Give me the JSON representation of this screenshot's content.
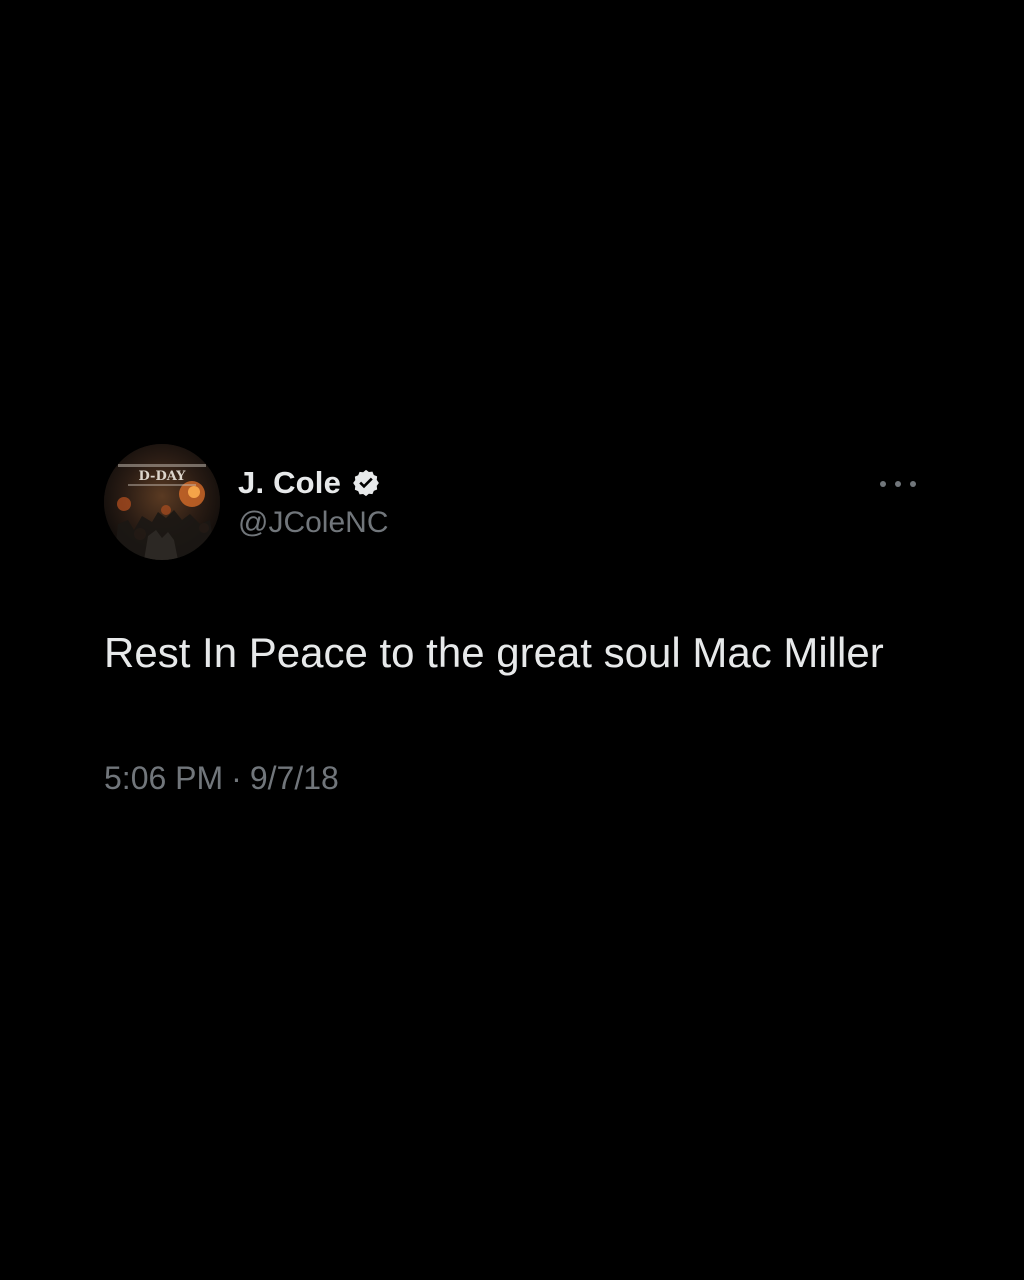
{
  "author": {
    "display_name": "J. Cole",
    "handle": "@JColeNC",
    "verified": true,
    "avatar_badge_text": "D-DAY"
  },
  "tweet": {
    "text": "Rest In Peace to the great soul Mac Miller",
    "time": "5:06 PM",
    "separator": "·",
    "date": "9/7/18"
  },
  "icons": {
    "verified": "verified-badge-icon",
    "more": "more-options-icon"
  },
  "colors": {
    "background": "#000000",
    "primary_text": "#e7e9ea",
    "secondary_text": "#71767b"
  }
}
